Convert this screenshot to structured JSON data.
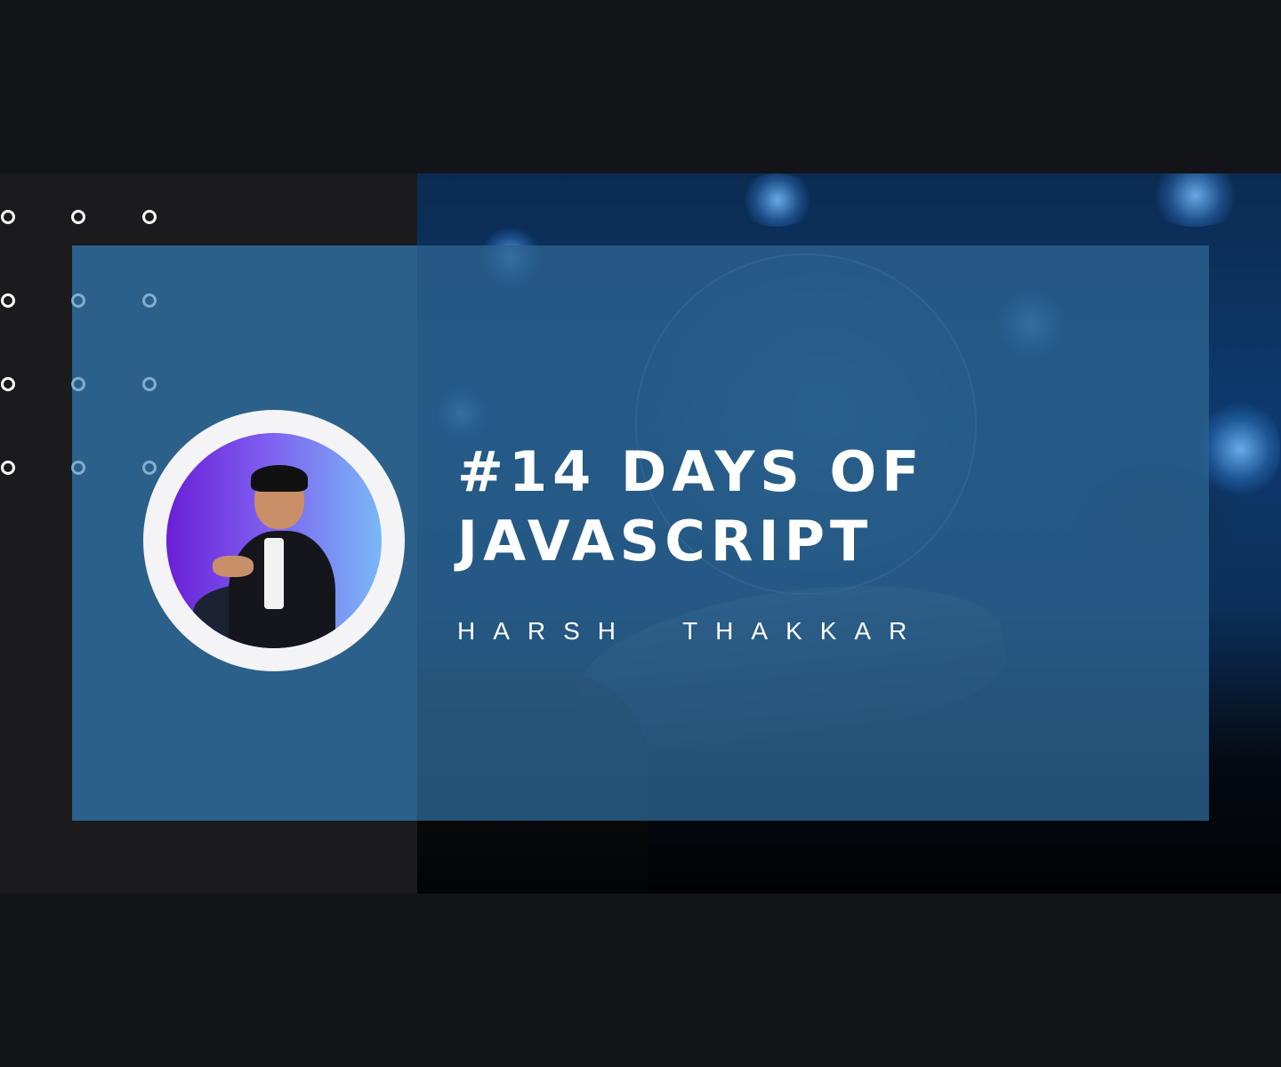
{
  "banner": {
    "title": "#14 DAYS OF\nJAVASCRIPT",
    "author": "HARSH  THAKKAR"
  },
  "colors": {
    "page_background": "#131418",
    "band_background": "#1b1a1c",
    "card_overlay": "#2b618e",
    "avatar_ring": "#f4f3f6",
    "avatar_gradient_start": "#6a1fd6",
    "avatar_gradient_end": "#79b8f7",
    "text": "#ffffff"
  },
  "icons": {
    "decoration": "circle-outline-grid",
    "avatar": "profile-photo"
  }
}
